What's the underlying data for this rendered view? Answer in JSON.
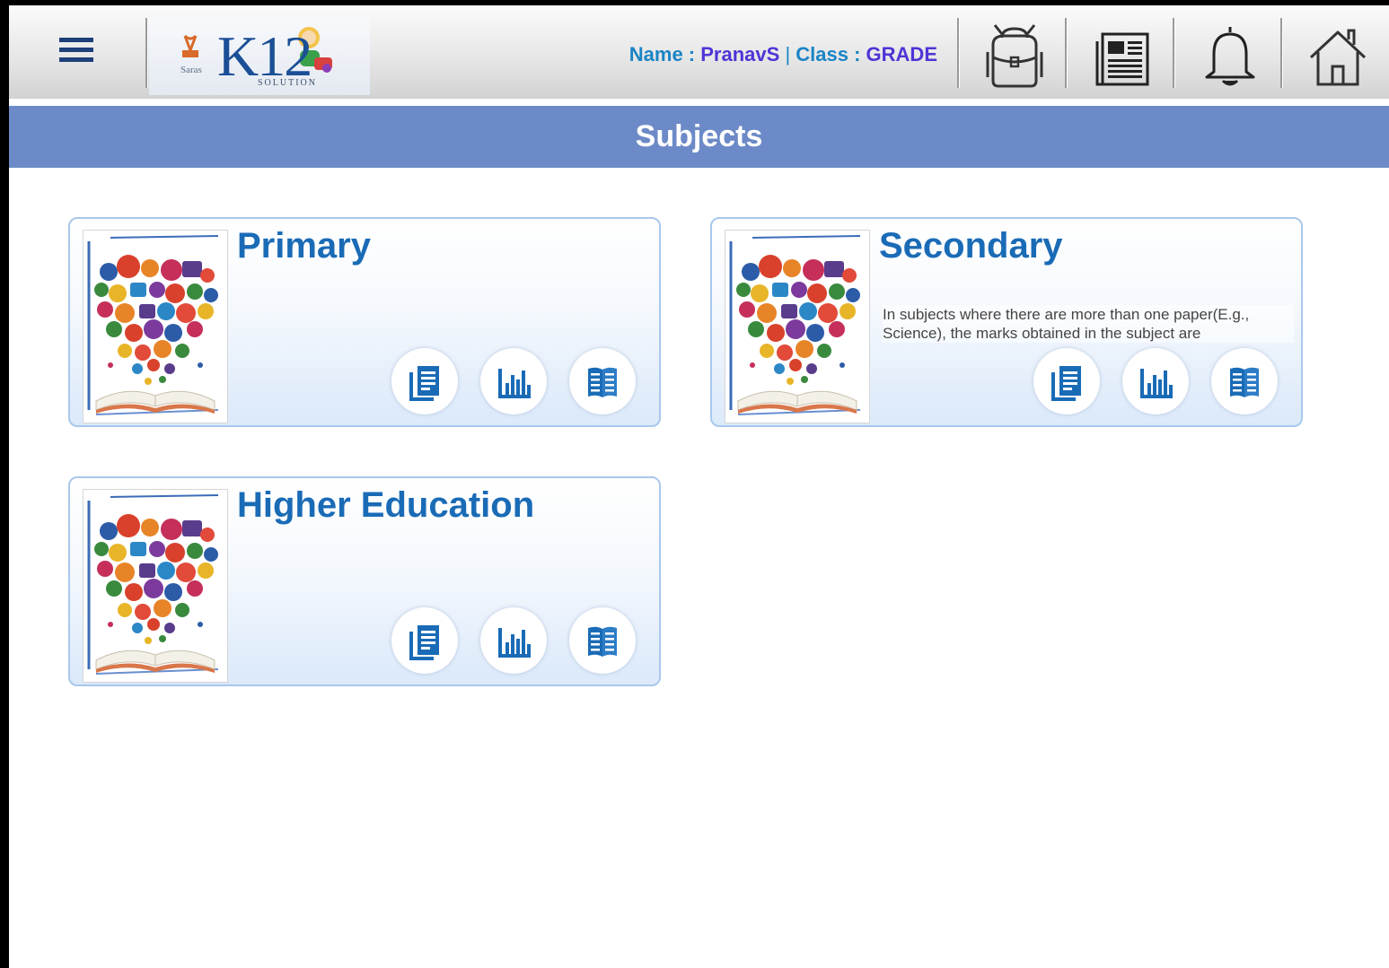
{
  "header": {
    "menu_icon": "hamburger-menu-icon",
    "logo": {
      "brand": "Saras",
      "mark": "K12",
      "tagline": "SOLUTION"
    },
    "user": {
      "name_label": "Name : ",
      "name_value": "PranavS",
      "separator": "|",
      "class_label": "Class : ",
      "class_value": "GRADE"
    },
    "toolbar": [
      {
        "id": "school-bag",
        "icon": "school-bag-icon"
      },
      {
        "id": "notice",
        "icon": "newspaper-icon"
      },
      {
        "id": "notifications",
        "icon": "bell-icon"
      },
      {
        "id": "home",
        "icon": "home-icon"
      }
    ]
  },
  "page": {
    "title": "Subjects"
  },
  "subjects": [
    {
      "title": "Primary",
      "description": "",
      "actions": [
        "document-icon",
        "bar-chart-icon",
        "open-book-icon"
      ]
    },
    {
      "title": "Secondary",
      "description": "In subjects where there are more than one paper(E.g., Science), the marks obtained in the subject are",
      "actions": [
        "document-icon",
        "bar-chart-icon",
        "open-book-icon"
      ]
    },
    {
      "title": "Higher Education",
      "description": "",
      "actions": [
        "document-icon",
        "bar-chart-icon",
        "open-book-icon"
      ]
    }
  ],
  "colors": {
    "accent_blue": "#1a6bb6",
    "title_strip": "#6c8ac7",
    "user_value": "#4f34d6",
    "user_label": "#1a84c6",
    "card_border": "#a9c8ec"
  }
}
